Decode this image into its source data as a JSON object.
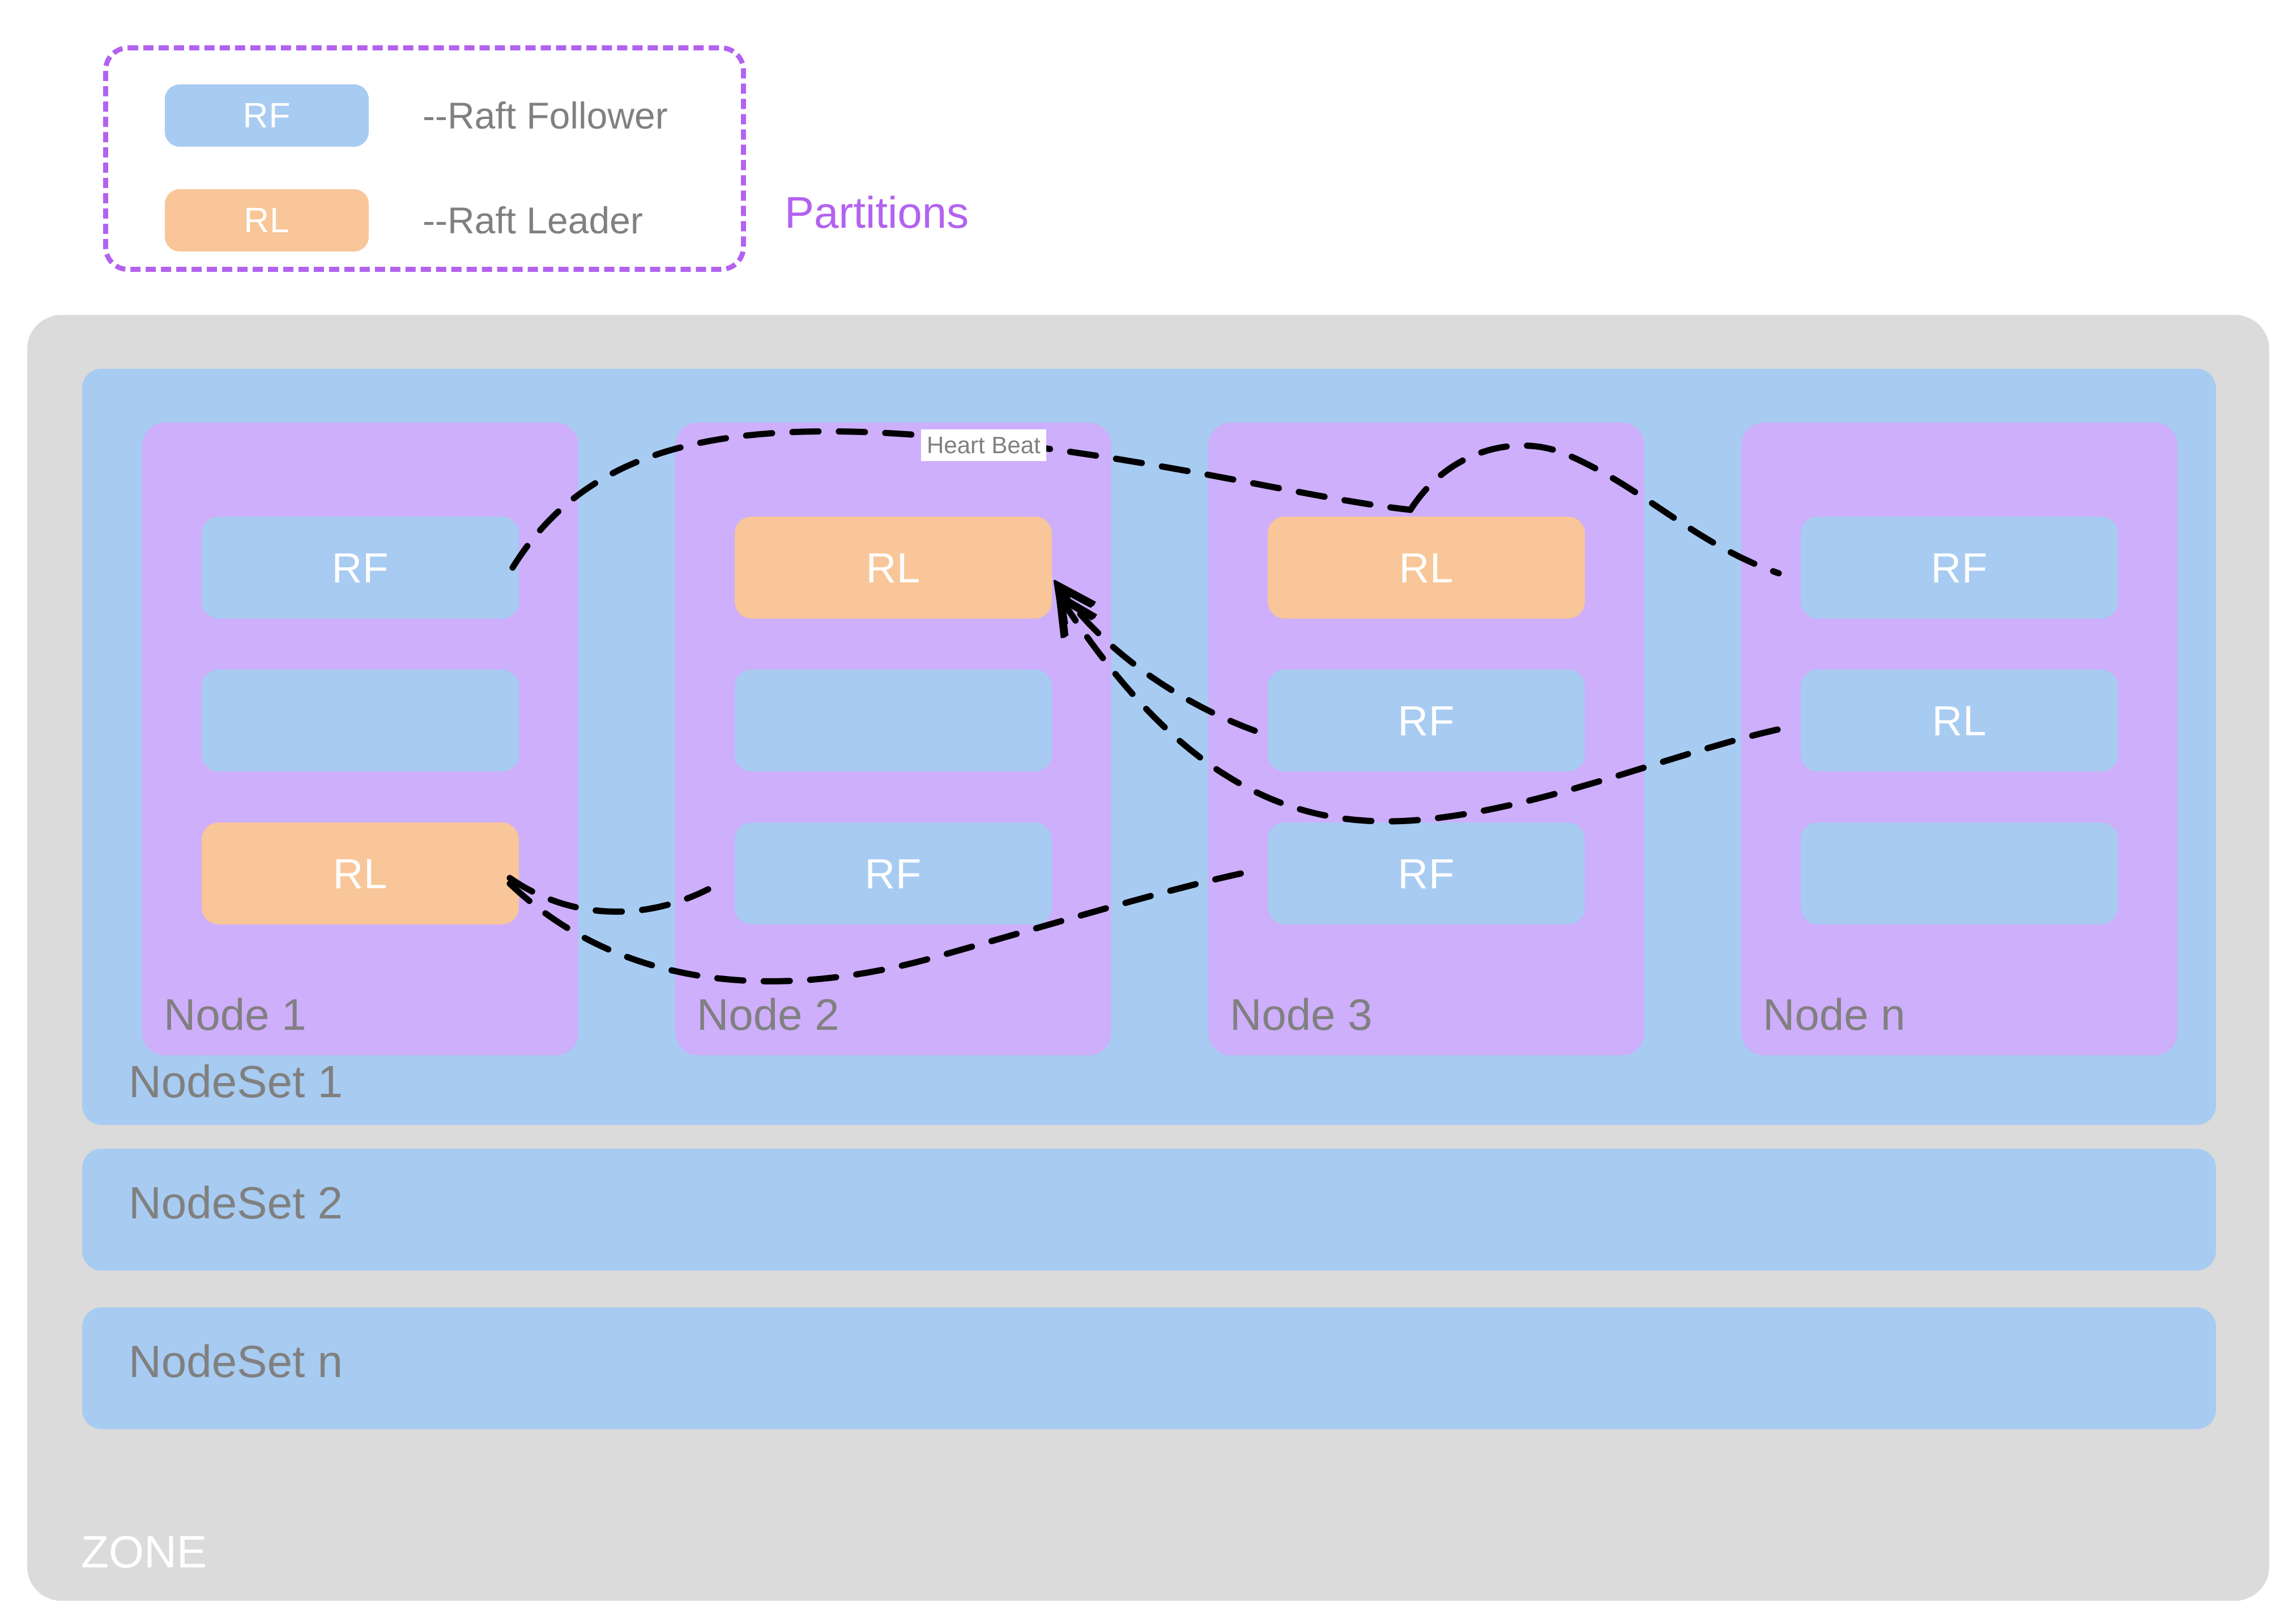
{
  "legend": {
    "title": "Partitions",
    "items": [
      {
        "abbr": "RF",
        "description": "--Raft Follower",
        "color": "#a8cbf1",
        "role": "follower"
      },
      {
        "abbr": "RL",
        "description": "--Raft Leader",
        "color": "#f8c698",
        "role": "leader"
      }
    ],
    "border_color": "#b362f0"
  },
  "zone": {
    "label": "ZONE",
    "color": "#dbdbdb",
    "label_color": "#ffffff"
  },
  "nodesets": [
    {
      "label": "NodeSet 1",
      "color": "#a8cbf1",
      "nodes": [
        {
          "label": "Node 1",
          "color": "#cdaffb",
          "slots": [
            {
              "label": "RF",
              "kind": "follower"
            },
            {
              "label": "",
              "kind": "empty"
            },
            {
              "label": "RL",
              "kind": "leader"
            }
          ]
        },
        {
          "label": "Node 2",
          "color": "#cdaffb",
          "slots": [
            {
              "label": "RL",
              "kind": "leader"
            },
            {
              "label": "",
              "kind": "empty"
            },
            {
              "label": "RF",
              "kind": "follower"
            }
          ]
        },
        {
          "label": "Node 3",
          "color": "#cdaffb",
          "slots": [
            {
              "label": "RL",
              "kind": "leader"
            },
            {
              "label": "RF",
              "kind": "follower"
            },
            {
              "label": "RF",
              "kind": "follower"
            }
          ]
        },
        {
          "label": "Node n",
          "color": "#cdaffb",
          "slots": [
            {
              "label": "RF",
              "kind": "follower"
            },
            {
              "label": "RL",
              "kind": "follower"
            },
            {
              "label": "",
              "kind": "empty"
            }
          ]
        }
      ]
    },
    {
      "label": "NodeSet 2",
      "color": "#a8cbf1",
      "nodes": []
    },
    {
      "label": "NodeSet n",
      "color": "#a8cbf1",
      "nodes": []
    }
  ],
  "edges": {
    "heartbeat_label": "Heart Beat",
    "line_color": "#000000",
    "style": "dashed"
  }
}
